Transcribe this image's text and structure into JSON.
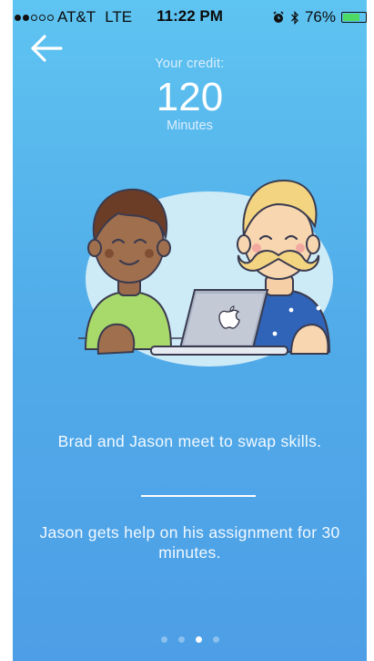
{
  "status_bar": {
    "signal_bars": 2,
    "signal_total": 5,
    "carrier": "AT&T",
    "network": "LTE",
    "time": "11:22 PM",
    "alarm_icon": "alarm-clock-icon",
    "bluetooth_icon": "bluetooth-icon",
    "battery_percent_label": "76%",
    "battery_level": 0.76,
    "battery_color": "#4cd964"
  },
  "nav": {
    "back_icon": "arrow-left-icon"
  },
  "credit": {
    "label": "Your credit:",
    "value": "120",
    "unit": "Minutes"
  },
  "illustration": {
    "name": "brad-and-jason-laptop-illustration",
    "laptop_logo_icon": "apple-logo-icon"
  },
  "onboarding": {
    "caption_top": "Brad and Jason meet to swap skills.",
    "caption_bottom": "Jason gets help on his assignment for 30 minutes."
  },
  "pagination": {
    "total": 4,
    "active_index": 2
  },
  "colors": {
    "background_top": "#5ec4f1",
    "background_bottom": "#4d9ee6",
    "text_light": "#f2f9ff"
  }
}
